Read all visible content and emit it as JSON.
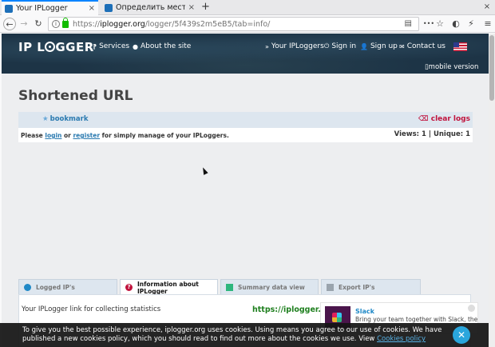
{
  "browser": {
    "tabs": [
      {
        "title": "Your IPLogger",
        "close": "×",
        "active": true,
        "favicon_color": "#1d6fb8"
      },
      {
        "title": "Определить месторасп",
        "close": "×",
        "active": false,
        "favicon_color": "#1d6fb8"
      }
    ],
    "new_tab": "+",
    "window_controls": {
      "close": "×"
    },
    "nav": {
      "back": "←",
      "forward": "→",
      "reload": "↻"
    },
    "url": {
      "prefix": "https://",
      "domain": "iplogger.org",
      "path": "/logger/5f439s2m5eB5/tab=info/"
    },
    "toolbar": {
      "more": "•••",
      "bookmark_star": "☆",
      "shield": "◐",
      "extension": "⚡",
      "menu": "≡"
    }
  },
  "site_header": {
    "logo": {
      "left": "IP L",
      "right": "GGER"
    },
    "nav": [
      {
        "icon": "⁋",
        "label": "Services"
      },
      {
        "icon": "●",
        "label": "About the site"
      },
      {
        "icon": "»",
        "label": "Your IPLoggers"
      },
      {
        "icon": "⏻",
        "label": "Sign in"
      },
      {
        "icon": "👤",
        "label": "Sign up"
      },
      {
        "icon": "✉",
        "label": "Contact us"
      }
    ],
    "mobile_version": "▯mobile version"
  },
  "main": {
    "title": "Shortened URL",
    "bookmark": "bookmark",
    "clear_logs": "clear logs",
    "please": {
      "before": "Please ",
      "login": "login",
      "or": " or ",
      "register": "register",
      "after": " for simply manage of your IPLoggers."
    },
    "views": "Views: 1 | Unique: 1"
  },
  "tabs": [
    {
      "label": "Logged IP's",
      "active": false,
      "icon_color": "#1e88c7"
    },
    {
      "label": "Information about IPLogger",
      "active": true,
      "icon_color": "#c0123c"
    },
    {
      "label": "Summary data view",
      "active": false,
      "icon_color": "#2eb67d"
    },
    {
      "label": "Export IP's",
      "active": false,
      "icon_color": "#9aa4ad"
    }
  ],
  "info_panel": {
    "label": "Your IPLogger link for collecting statistics",
    "link": "https://iplogger.org/"
  },
  "ad": {
    "title": "Slack",
    "text": "Bring your team together with Slack, the"
  },
  "cookie_banner": {
    "text": "To give you the best possible experience, iplogger.org uses cookies. Using means you agree to our use of cookies. We have published a new cookies policy, which you should read to find out more about the cookies we use. View ",
    "link": "Cookies policy",
    "close": "✕"
  },
  "colors": {
    "header_bg": "#1d3446",
    "accent_blue": "#2a7ab0",
    "clear_logs_red": "#c0123c",
    "link_green": "#1e7f1e",
    "cookie_close": "#2aa6dc"
  }
}
